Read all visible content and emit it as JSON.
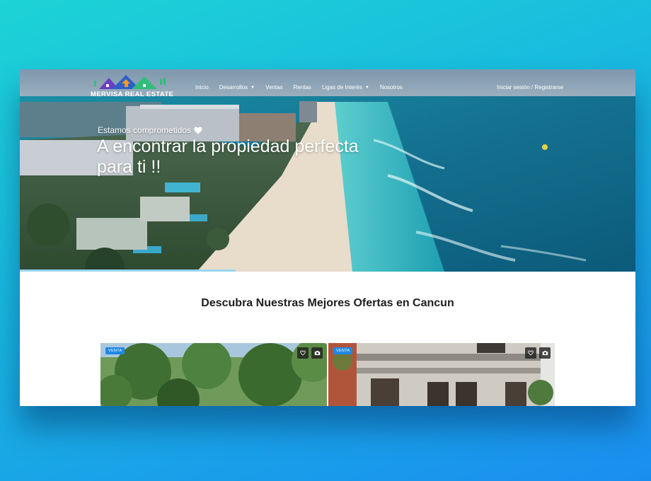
{
  "brand": {
    "name": "MERVISA REAL ESTATE",
    "colors": {
      "accent_blue": "#1e88e5",
      "roof_blue": "#2f5fc9",
      "roof_purple": "#6a3fc1",
      "roof_green": "#2fbf7a",
      "roof_orange": "#f39a1e"
    }
  },
  "nav": {
    "items": [
      {
        "label": "Inicio",
        "dropdown": false
      },
      {
        "label": "Desarrollos",
        "dropdown": true
      },
      {
        "label": "Ventas",
        "dropdown": false
      },
      {
        "label": "Rentas",
        "dropdown": false
      },
      {
        "label": "Ligas de Interés",
        "dropdown": true
      },
      {
        "label": "Nosotros",
        "dropdown": false
      }
    ],
    "caret_icon": "chevron-down-icon",
    "auth_label": "Iniciar sesión / Registrarse"
  },
  "hero": {
    "subtitle": "Estamos comprometidos",
    "subtitle_icon": "heart-icon",
    "title": "A encontrar la propiedad perfecta para ti !!",
    "slide_progress": 0.35
  },
  "listings": {
    "heading": "Descubra Nuestras Mejores Ofertas en Cancun",
    "cards": [
      {
        "badge": "VENTA",
        "favorite_icon": "heart-outline-icon",
        "photos_icon": "camera-icon"
      },
      {
        "badge": "VENTA",
        "favorite_icon": "heart-outline-icon",
        "photos_icon": "camera-icon"
      }
    ]
  }
}
